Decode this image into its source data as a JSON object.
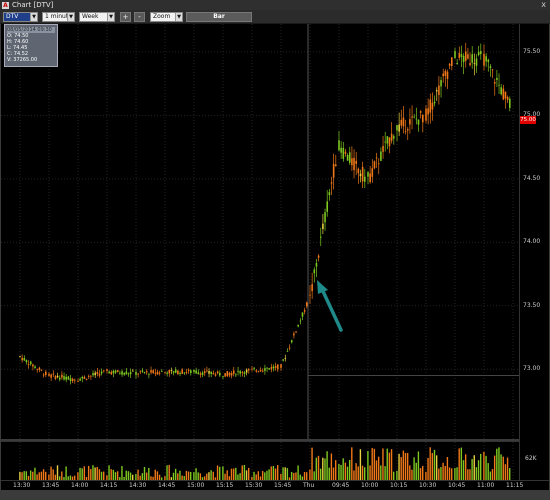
{
  "window": {
    "title": "Chart [DTV]",
    "close_symbol": "x"
  },
  "toolbar": {
    "symbol": "DTV",
    "interval": "1 minute",
    "range": "Week",
    "plus_label": "+",
    "minus_label": "-",
    "zoom": "Zoom",
    "bar_label": "Bar"
  },
  "info_box": {
    "header": "08/05/2014 09:30",
    "open": "O: 74.50",
    "high": "H: 74.60",
    "low": "L: 74.45",
    "close": "C: 74.52",
    "volume": "V: 37265.00"
  },
  "y_axis": {
    "labels": [
      "75.50",
      "75.00",
      "74.50",
      "74.00",
      "73.50",
      "73.00"
    ],
    "last_price": "75.00",
    "volume_label": "62K"
  },
  "x_axis": {
    "labels": [
      "13:30",
      "13:45",
      "14:00",
      "14:15",
      "14:30",
      "14:45",
      "15:00",
      "15:15",
      "15:30",
      "15:45",
      "Thu",
      "09:45",
      "10:00",
      "10:15",
      "10:30",
      "10:45",
      "11:00",
      "11:15"
    ]
  },
  "colors": {
    "up": "#7ec820",
    "down": "#f07818",
    "highlight": "#e8d040",
    "arrow": "#1e8a8a",
    "last_price_bg": "#e00000"
  },
  "chart_data": {
    "type": "line",
    "ylim": [
      72.45,
      75.72
    ],
    "xlabel": "",
    "ylabel": "",
    "x": [
      "13:30",
      "13:45",
      "14:00",
      "14:15",
      "14:30",
      "14:45",
      "15:00",
      "15:15",
      "15:30",
      "15:45",
      "Thu",
      "09:45",
      "10:00",
      "10:15",
      "10:30",
      "10:45",
      "11:00",
      "11:15"
    ],
    "series": [
      {
        "values": [
          73.1,
          72.95,
          72.92,
          72.98,
          72.97,
          72.98,
          72.98,
          72.96,
          72.99,
          73.02,
          73.55,
          74.75,
          74.5,
          74.9,
          75.0,
          75.45,
          75.45,
          75.05
        ]
      }
    ]
  }
}
